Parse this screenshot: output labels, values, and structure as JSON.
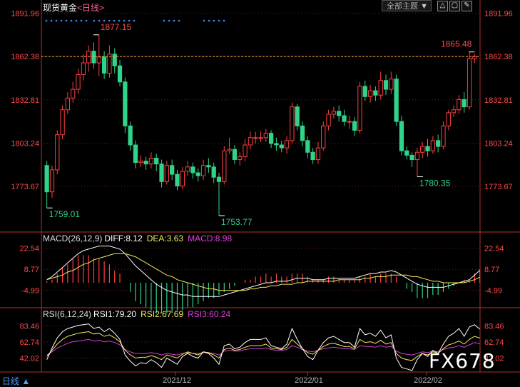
{
  "header": {
    "symbol": "现货黄金",
    "period_label": "<日线>",
    "theme_dropdown": "全部主题",
    "theme_arrow": "▼",
    "tool_buttons": [
      "△",
      "▢",
      "✎"
    ]
  },
  "footer": {
    "period_tab": "日线 ▲",
    "watermark": "FX678"
  },
  "colors": {
    "up": "#ff4040",
    "down": "#2fd38a",
    "diff": "#ffffff",
    "dea": "#f5ea5a",
    "macd": "#e040e0",
    "rsi1": "#ffffff",
    "rsi2": "#f5ea5a",
    "rsi3": "#d040d0",
    "grid": "#b0302a",
    "price_line": "#ffb03a",
    "dots": "#3a8ef0"
  },
  "chart_data": [
    {
      "type": "candlestick",
      "name": "price",
      "ylim": [
        1745,
        1898
      ],
      "y_ticks": [
        1891.96,
        1862.38,
        1832.81,
        1803.24,
        1773.67
      ],
      "x_labels": [
        "2021/12",
        "2022/01",
        "2022/02"
      ],
      "current_price": 1862.38,
      "annotations": [
        {
          "text": "1877.15",
          "index": 10,
          "value": 1877.15,
          "kind": "high"
        },
        {
          "text": "1759.01",
          "index": 0,
          "value": 1759.01,
          "kind": "low"
        },
        {
          "text": "1753.77",
          "index": 33,
          "value": 1753.77,
          "kind": "low"
        },
        {
          "text": "1780.35",
          "index": 71,
          "value": 1780.35,
          "kind": "low"
        },
        {
          "text": "1865.48",
          "index": 82,
          "value": 1865.48,
          "kind": "high"
        }
      ],
      "candles": [
        [
          1788,
          1770,
          1791,
          1759.01
        ],
        [
          1770,
          1785,
          1788,
          1766
        ],
        [
          1785,
          1809,
          1812,
          1782
        ],
        [
          1809,
          1826,
          1829,
          1806
        ],
        [
          1826,
          1834,
          1838,
          1823
        ],
        [
          1834,
          1840,
          1845,
          1831
        ],
        [
          1840,
          1850,
          1854,
          1837
        ],
        [
          1850,
          1858,
          1864,
          1846
        ],
        [
          1858,
          1866,
          1870,
          1852
        ],
        [
          1866,
          1858,
          1872,
          1854
        ],
        [
          1858,
          1862,
          1877.15,
          1849
        ],
        [
          1862,
          1851,
          1866,
          1847
        ],
        [
          1851,
          1864,
          1870,
          1848
        ],
        [
          1864,
          1856,
          1868,
          1851
        ],
        [
          1856,
          1845,
          1860,
          1842
        ],
        [
          1845,
          1815,
          1848,
          1810
        ],
        [
          1815,
          1802,
          1818,
          1798
        ],
        [
          1802,
          1790,
          1805,
          1786
        ],
        [
          1790,
          1791,
          1795,
          1787
        ],
        [
          1791,
          1789,
          1794,
          1785
        ],
        [
          1789,
          1793,
          1797,
          1786
        ],
        [
          1793,
          1789,
          1796,
          1784
        ],
        [
          1789,
          1777,
          1792,
          1773
        ],
        [
          1777,
          1788,
          1791,
          1775
        ],
        [
          1788,
          1782,
          1792,
          1778
        ],
        [
          1782,
          1774,
          1785,
          1771
        ],
        [
          1774,
          1784,
          1787,
          1772
        ],
        [
          1784,
          1787,
          1791,
          1781
        ],
        [
          1787,
          1783,
          1790,
          1779
        ],
        [
          1783,
          1781,
          1786,
          1777
        ],
        [
          1781,
          1788,
          1792,
          1778
        ],
        [
          1788,
          1787,
          1793,
          1783
        ],
        [
          1787,
          1780,
          1790,
          1776
        ],
        [
          1780,
          1777,
          1783,
          1753.77
        ],
        [
          1777,
          1798,
          1801,
          1775
        ],
        [
          1798,
          1799,
          1807,
          1796
        ],
        [
          1799,
          1792,
          1802,
          1789
        ],
        [
          1792,
          1794,
          1797,
          1788
        ],
        [
          1794,
          1802,
          1806,
          1791
        ],
        [
          1802,
          1807,
          1811,
          1799
        ],
        [
          1807,
          1807,
          1811,
          1803
        ],
        [
          1807,
          1807,
          1811,
          1804
        ],
        [
          1807,
          1810,
          1813,
          1804
        ],
        [
          1810,
          1803,
          1812,
          1800
        ],
        [
          1803,
          1802,
          1807,
          1798
        ],
        [
          1802,
          1800,
          1805,
          1797
        ],
        [
          1800,
          1805,
          1808,
          1796
        ],
        [
          1805,
          1828,
          1831,
          1803
        ],
        [
          1828,
          1815,
          1830,
          1812
        ],
        [
          1815,
          1805,
          1818,
          1801
        ],
        [
          1805,
          1797,
          1808,
          1793
        ],
        [
          1797,
          1792,
          1800,
          1789
        ],
        [
          1792,
          1800,
          1804,
          1789
        ],
        [
          1800,
          1815,
          1818,
          1798
        ],
        [
          1815,
          1823,
          1826,
          1812
        ],
        [
          1823,
          1825,
          1828,
          1820
        ],
        [
          1825,
          1822,
          1829,
          1818
        ],
        [
          1822,
          1818,
          1826,
          1815
        ],
        [
          1818,
          1818,
          1822,
          1813
        ],
        [
          1818,
          1812,
          1821,
          1808
        ],
        [
          1812,
          1842,
          1845,
          1810
        ],
        [
          1842,
          1835,
          1846,
          1832
        ],
        [
          1835,
          1839,
          1843,
          1831
        ],
        [
          1839,
          1836,
          1842,
          1832
        ],
        [
          1836,
          1846,
          1852,
          1833
        ],
        [
          1846,
          1840,
          1850,
          1836
        ],
        [
          1840,
          1847,
          1852,
          1837
        ],
        [
          1847,
          1818,
          1850,
          1815
        ],
        [
          1818,
          1798,
          1822,
          1795
        ],
        [
          1798,
          1795,
          1801,
          1792
        ],
        [
          1795,
          1792,
          1797,
          1787
        ],
        [
          1792,
          1797,
          1800,
          1780.35
        ],
        [
          1797,
          1801,
          1804,
          1793
        ],
        [
          1801,
          1798,
          1806,
          1794
        ],
        [
          1798,
          1805,
          1808,
          1796
        ],
        [
          1805,
          1801,
          1809,
          1797
        ],
        [
          1801,
          1815,
          1818,
          1799
        ],
        [
          1815,
          1824,
          1826,
          1812
        ],
        [
          1824,
          1826,
          1829,
          1821
        ],
        [
          1826,
          1833,
          1836,
          1823
        ],
        [
          1833,
          1828,
          1838,
          1824
        ],
        [
          1828,
          1861,
          1865.48,
          1826
        ],
        [
          1861,
          1862.38,
          1864,
          1858
        ]
      ]
    },
    {
      "type": "bar+line",
      "name": "MACD",
      "title": "MACD(26,12,9)",
      "legend": [
        "DIFF:8.12",
        "DEA:3.63",
        "MACD:8.98"
      ],
      "ylim": [
        -14,
        28
      ],
      "y_ticks": [
        22.54,
        8.77,
        -4.99
      ],
      "series": [
        {
          "name": "DIFF",
          "values": [
            2,
            4,
            7,
            10,
            13,
            16,
            19,
            21,
            22,
            23,
            24,
            24,
            24,
            23,
            22,
            19,
            15,
            11,
            8,
            5,
            2,
            -1,
            -3,
            -5,
            -6,
            -7,
            -8,
            -8,
            -9,
            -9,
            -9,
            -9,
            -9,
            -9,
            -8,
            -7,
            -6,
            -5,
            -4,
            -3,
            -2,
            -1,
            0,
            0,
            1,
            1,
            1,
            2,
            3,
            3,
            3,
            2,
            2,
            2,
            3,
            3,
            3,
            3,
            3,
            3,
            4,
            5,
            6,
            6,
            7,
            7,
            8,
            7,
            5,
            3,
            1,
            -1,
            -2,
            -3,
            -3,
            -3,
            -3,
            -2,
            -1,
            0,
            1,
            2,
            5,
            8.12
          ]
        },
        {
          "name": "DEA",
          "values": [
            2,
            3,
            4,
            5,
            7,
            8,
            10,
            12,
            13,
            15,
            16,
            17,
            18,
            19,
            19,
            19,
            18,
            17,
            15,
            13,
            11,
            9,
            7,
            5,
            4,
            2,
            1,
            0,
            -1,
            -2,
            -3,
            -4,
            -4,
            -5,
            -5,
            -5,
            -5,
            -5,
            -5,
            -4,
            -4,
            -3,
            -3,
            -2,
            -2,
            -1,
            -1,
            -1,
            0,
            0,
            1,
            1,
            1,
            1,
            1,
            1,
            2,
            2,
            2,
            2,
            2,
            3,
            3,
            4,
            4,
            4,
            5,
            5,
            5,
            5,
            4,
            4,
            3,
            2,
            1,
            1,
            0,
            0,
            0,
            0,
            0,
            1,
            2,
            3.63
          ]
        },
        {
          "name": "MACD",
          "values": [
            1,
            2,
            6,
            10,
            12,
            16,
            18,
            18,
            18,
            16,
            16,
            14,
            12,
            8,
            6,
            0,
            -6,
            -12,
            -14,
            -16,
            -18,
            -20,
            -20,
            -20,
            -20,
            -18,
            -18,
            -16,
            -16,
            -14,
            -12,
            -10,
            -10,
            -8,
            -6,
            -4,
            -2,
            0,
            2,
            2,
            4,
            4,
            6,
            4,
            6,
            4,
            4,
            6,
            6,
            6,
            4,
            2,
            2,
            2,
            4,
            4,
            2,
            2,
            2,
            2,
            4,
            4,
            6,
            4,
            6,
            6,
            6,
            4,
            0,
            -4,
            -6,
            -10,
            -10,
            -10,
            -8,
            -8,
            -6,
            -4,
            -2,
            0,
            2,
            2,
            6,
            8.98
          ]
        }
      ]
    },
    {
      "type": "line",
      "name": "RSI",
      "title": "RSI(6,12,24)",
      "legend": [
        "RSI1:79.20",
        "RSI2:67.69",
        "RSI3:60.24"
      ],
      "ylim": [
        25,
        93
      ],
      "y_ticks": [
        83.46,
        62.74,
        42.02
      ],
      "series": [
        {
          "name": "RSI1",
          "values": [
            40,
            55,
            68,
            76,
            80,
            82,
            84,
            85,
            86,
            80,
            82,
            76,
            80,
            74,
            66,
            46,
            38,
            32,
            36,
            35,
            40,
            36,
            30,
            42,
            38,
            34,
            44,
            48,
            44,
            42,
            50,
            48,
            42,
            34,
            58,
            60,
            54,
            56,
            62,
            66,
            66,
            66,
            68,
            58,
            56,
            54,
            60,
            80,
            66,
            54,
            44,
            40,
            52,
            62,
            68,
            70,
            66,
            62,
            62,
            56,
            80,
            72,
            74,
            70,
            78,
            68,
            72,
            42,
            30,
            28,
            26,
            40,
            48,
            44,
            52,
            48,
            60,
            70,
            74,
            80,
            70,
            82,
            85,
            79.2
          ]
        },
        {
          "name": "RSI2",
          "values": [
            44,
            52,
            60,
            66,
            70,
            72,
            74,
            75,
            76,
            73,
            74,
            70,
            72,
            68,
            63,
            52,
            46,
            42,
            43,
            43,
            45,
            43,
            40,
            46,
            44,
            42,
            47,
            50,
            48,
            46,
            50,
            49,
            46,
            42,
            53,
            55,
            52,
            53,
            56,
            58,
            58,
            58,
            60,
            55,
            54,
            53,
            56,
            66,
            60,
            54,
            49,
            47,
            52,
            57,
            60,
            61,
            59,
            57,
            57,
            54,
            66,
            62,
            63,
            61,
            65,
            60,
            62,
            48,
            42,
            40,
            39,
            44,
            48,
            46,
            50,
            48,
            54,
            59,
            61,
            64,
            60,
            66,
            70,
            67.69
          ]
        },
        {
          "name": "RSI3",
          "values": [
            46,
            50,
            55,
            58,
            61,
            63,
            64,
            65,
            66,
            64,
            65,
            63,
            64,
            62,
            59,
            53,
            50,
            48,
            48,
            48,
            49,
            48,
            46,
            48,
            47,
            46,
            48,
            49,
            48,
            48,
            49,
            49,
            48,
            46,
            51,
            52,
            51,
            51,
            53,
            54,
            54,
            54,
            55,
            53,
            52,
            52,
            53,
            58,
            56,
            53,
            51,
            50,
            52,
            54,
            55,
            56,
            55,
            54,
            54,
            53,
            58,
            57,
            57,
            56,
            58,
            56,
            57,
            51,
            48,
            47,
            46,
            48,
            50,
            49,
            51,
            50,
            53,
            55,
            56,
            58,
            56,
            59,
            62,
            60.24
          ]
        }
      ]
    }
  ]
}
